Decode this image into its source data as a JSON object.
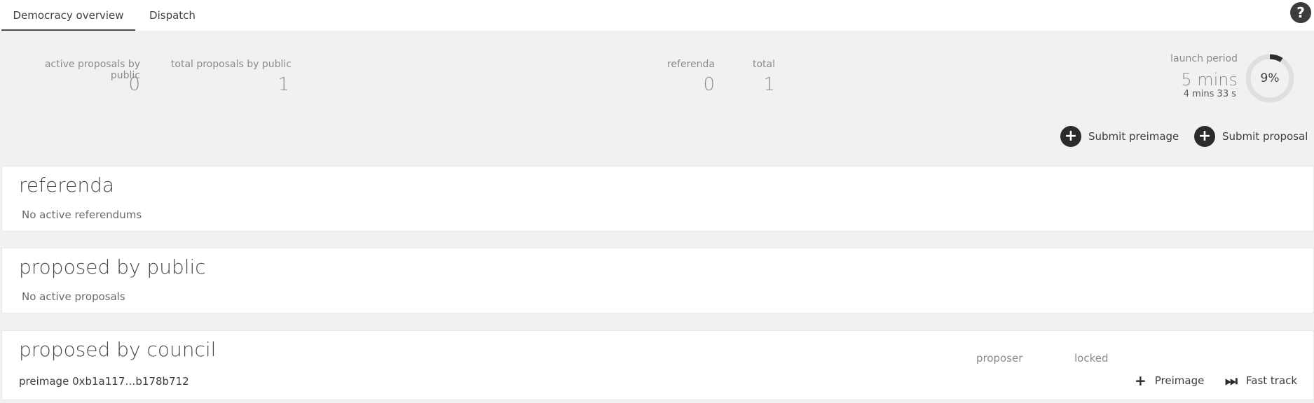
{
  "tabs": [
    {
      "label": "Democracy overview",
      "active": true
    },
    {
      "label": "Dispatch",
      "active": false
    }
  ],
  "summary": {
    "active_proposals_label": "active proposals by public",
    "active_proposals_value": "0",
    "total_proposals_label": "total proposals by public",
    "total_proposals_value": "1",
    "referenda_label": "referenda",
    "referenda_value": "0",
    "total_label": "total",
    "total_value": "1",
    "launch_period_label": "launch period",
    "launch_period_value": "5 mins",
    "launch_period_remaining": "4 mins 33 s",
    "launch_progress_text": "9%",
    "launch_progress_fraction": 0.09
  },
  "actions": {
    "submit_preimage": "Submit preimage",
    "submit_proposal": "Submit proposal"
  },
  "referenda": {
    "title": "referenda",
    "empty": "No active referendums"
  },
  "public": {
    "title": "proposed by public",
    "empty": "No active proposals"
  },
  "council": {
    "title": "proposed by council",
    "col_proposer": "proposer",
    "col_locked": "locked",
    "row": {
      "preimage": "preimage 0xb1a117…b178b712",
      "preimage_action": "Preimage",
      "fast_track_action": "Fast track"
    }
  },
  "colors": {
    "background": "#f2f1f0",
    "panel": "#ffffff",
    "accent": "#2b2b2b"
  },
  "icons": {
    "help": "help-icon",
    "plus": "plus-icon",
    "fast_track": "fast-forward-icon"
  }
}
